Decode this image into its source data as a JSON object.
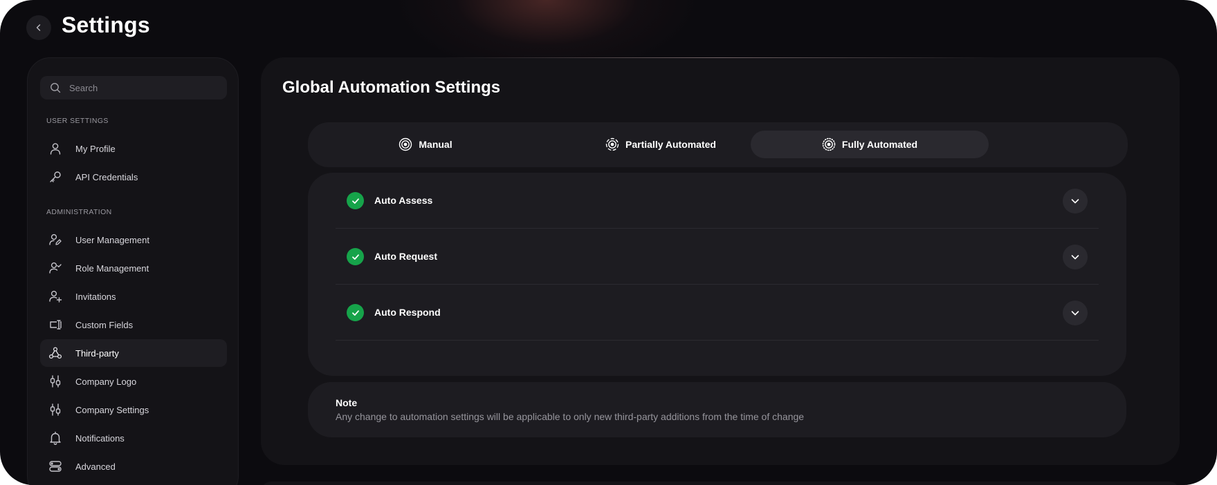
{
  "header": {
    "title": "Settings",
    "back_icon": "chevron-left-icon"
  },
  "sidebar": {
    "search_placeholder": "Search",
    "sections": [
      {
        "label": "USER SETTINGS",
        "items": [
          {
            "label": "My Profile",
            "icon": "user-icon"
          },
          {
            "label": "API Credentials",
            "icon": "key-icon"
          }
        ]
      },
      {
        "label": "ADMINISTRATION",
        "items": [
          {
            "label": "User Management",
            "icon": "user-edit-icon"
          },
          {
            "label": "Role Management",
            "icon": "user-check-icon"
          },
          {
            "label": "Invitations",
            "icon": "user-plus-icon"
          },
          {
            "label": "Custom Fields",
            "icon": "text-field-icon"
          },
          {
            "label": "Third-party",
            "icon": "network-icon",
            "active": true
          },
          {
            "label": "Company Logo",
            "icon": "sliders-icon"
          },
          {
            "label": "Company Settings",
            "icon": "sliders-icon"
          },
          {
            "label": "Notifications",
            "icon": "bell-icon"
          },
          {
            "label": "Advanced",
            "icon": "toggles-icon"
          }
        ]
      }
    ]
  },
  "main": {
    "title": "Global Automation Settings",
    "tabs": [
      {
        "label": "Manual",
        "icon": "target-icon"
      },
      {
        "label": "Partially Automated",
        "icon": "target-dashed-icon"
      },
      {
        "label": "Fully Automated",
        "icon": "target-dotted-icon",
        "active": true
      }
    ],
    "options": [
      {
        "label": "Auto Assess",
        "checked": true
      },
      {
        "label": "Auto Request",
        "checked": true
      },
      {
        "label": "Auto Respond",
        "checked": true
      }
    ],
    "note": {
      "title": "Note",
      "text": "Any change to automation settings will be applicable to only new third-party additions from the time of change"
    }
  },
  "colors": {
    "background": "#0c0b0f",
    "panel": "#141317",
    "card": "#1d1c21",
    "check_green": "#16a34a"
  }
}
